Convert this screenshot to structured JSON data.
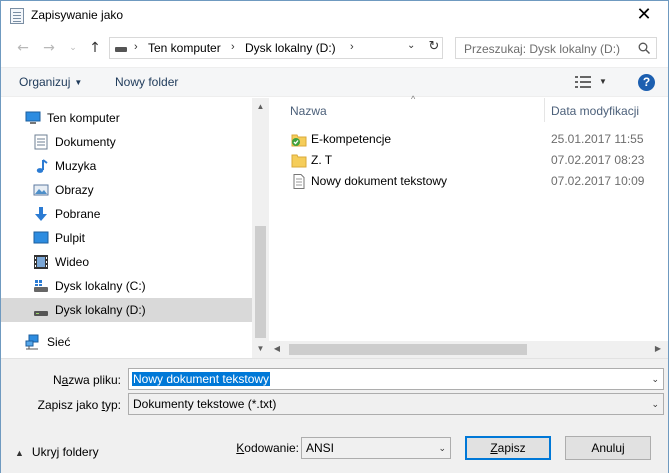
{
  "window": {
    "title": "Zapisywanie jako"
  },
  "address": {
    "crumbs": [
      "Ten komputer",
      "Dysk lokalny (D:)"
    ],
    "search_placeholder": "Przeszukaj: Dysk lokalny (D:)"
  },
  "toolbar": {
    "organize": "Organizuj",
    "new_folder": "Nowy folder",
    "help": "?"
  },
  "nav": {
    "items": [
      {
        "label": "Ten komputer",
        "icon": "computer-icon"
      },
      {
        "label": "Dokumenty",
        "icon": "documents-icon"
      },
      {
        "label": "Muzyka",
        "icon": "music-icon"
      },
      {
        "label": "Obrazy",
        "icon": "pictures-icon"
      },
      {
        "label": "Pobrane",
        "icon": "downloads-icon"
      },
      {
        "label": "Pulpit",
        "icon": "desktop-icon"
      },
      {
        "label": "Wideo",
        "icon": "video-icon"
      },
      {
        "label": "Dysk lokalny (C:)",
        "icon": "drive-c-icon"
      },
      {
        "label": "Dysk lokalny (D:)",
        "icon": "drive-d-icon",
        "selected": true
      },
      {
        "label": "Sieć",
        "icon": "network-icon"
      }
    ]
  },
  "files": {
    "columns": {
      "name": "Nazwa",
      "date": "Data modyfikacji"
    },
    "rows": [
      {
        "name": "E-kompetencje",
        "date": "25.01.2017 11:55",
        "icon": "synced-folder-icon"
      },
      {
        "name": "Z. T",
        "date": "07.02.2017 08:23",
        "icon": "folder-icon"
      },
      {
        "name": "Nowy dokument tekstowy",
        "date": "07.02.2017 10:09",
        "icon": "text-file-icon"
      }
    ]
  },
  "form": {
    "filename_label_pre": "N",
    "filename_label_ul": "a",
    "filename_label_post": "zwa pliku:",
    "filename_value": "Nowy dokument tekstowy",
    "type_label_pre": "Zapisz jako ",
    "type_label_ul": "t",
    "type_label_post": "yp:",
    "type_value": "Dokumenty tekstowe (*.txt)",
    "hide_folders": "Ukryj foldery",
    "encoding_label_ul": "K",
    "encoding_label_post": "odowanie:",
    "encoding_value": "ANSI",
    "save_ul": "Z",
    "save_post": "apisz",
    "cancel": "Anuluj"
  },
  "colors": {
    "accent": "#0078d7",
    "selected_nav": "#d9d9d9",
    "help_blue": "#1c5fb0",
    "folder_yellow": "#f5cd5a"
  }
}
